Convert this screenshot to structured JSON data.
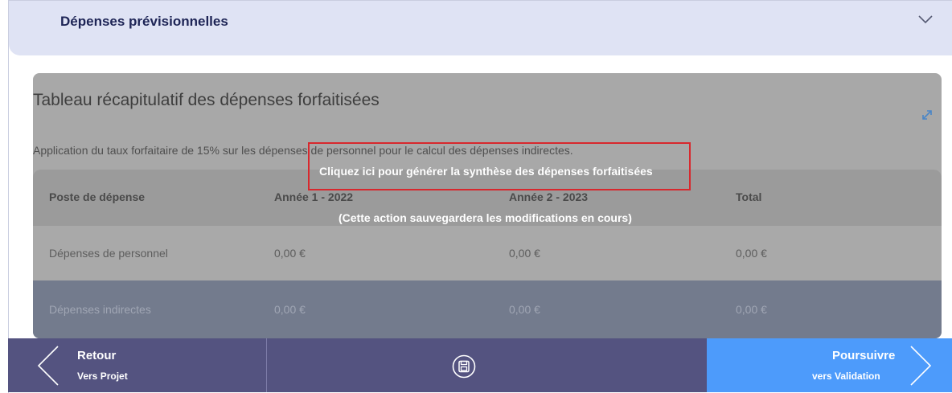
{
  "section": {
    "title": "Dépenses prévisionnelles",
    "chevron_icon": "chevron-down-icon"
  },
  "card": {
    "title": "Tableau récapitulatif des dépenses forfaitisées",
    "description": "Application du taux forfaitaire de 15% sur les dépenses de personnel pour le calcul des dépenses indirectes.",
    "expand_icon": "expand-icon"
  },
  "table": {
    "headers": [
      "Poste de dépense",
      "Année 1 - 2022",
      "Année 2 - 2023",
      "Total"
    ],
    "rows": [
      [
        "Dépenses de personnel",
        "0,00 €",
        "0,00 €",
        "0,00 €"
      ],
      [
        "Dépenses indirectes",
        "0,00 €",
        "0,00 €",
        "0,00 €"
      ]
    ]
  },
  "overlay": {
    "cta": "Cliquez ici pour générer la synthèse des dépenses forfaitisées",
    "note": "(Cette action sauvegardera les modifications en cours)"
  },
  "footer": {
    "back": {
      "label": "Retour",
      "sub": "Vers Projet"
    },
    "save_icon": "save-icon",
    "next": {
      "label": "Poursuivre",
      "sub": "vers Validation"
    }
  },
  "colors": {
    "header_bg": "#dfe3f4",
    "overlay_bg": "#a8a8a8",
    "highlight_border": "#d8282d",
    "footer_dark": "#545380",
    "footer_accent": "#4d9bfb"
  }
}
